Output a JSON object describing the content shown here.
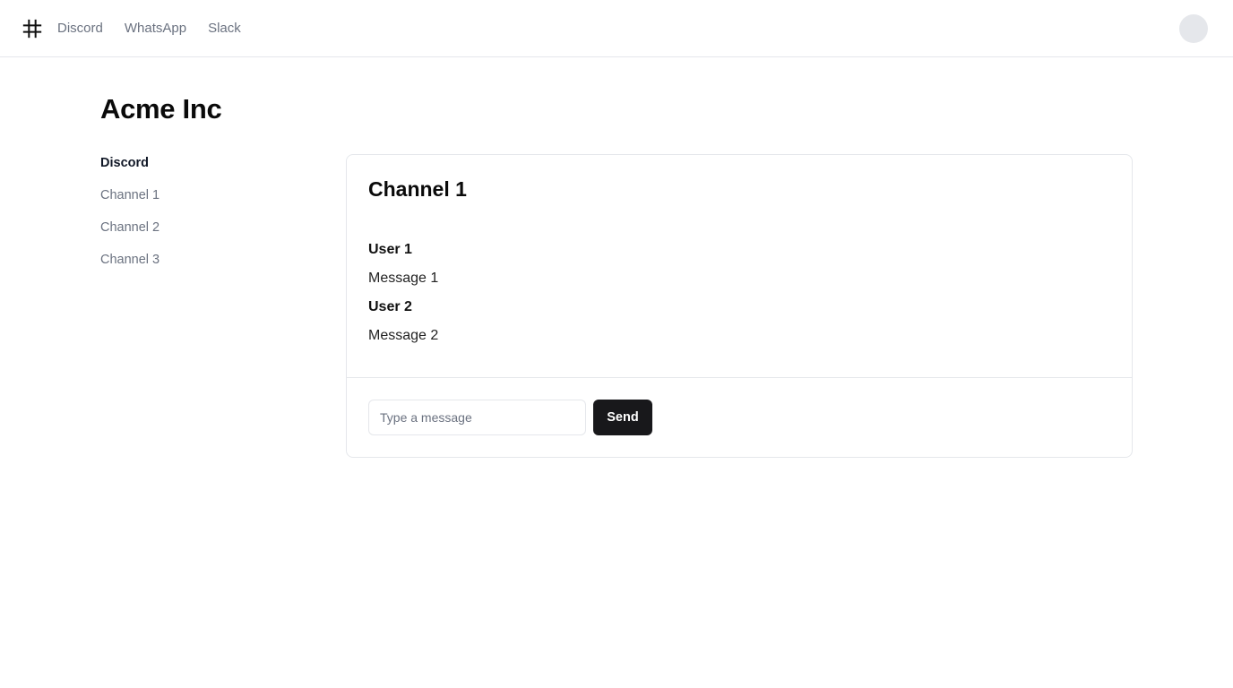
{
  "nav": {
    "logo_icon": "hash-icon",
    "links": [
      "Discord",
      "WhatsApp",
      "Slack"
    ]
  },
  "org": {
    "title": "Acme Inc"
  },
  "sidebar": {
    "items": [
      {
        "label": "Discord",
        "active": true
      },
      {
        "label": "Channel 1",
        "active": false
      },
      {
        "label": "Channel 2",
        "active": false
      },
      {
        "label": "Channel 3",
        "active": false
      }
    ]
  },
  "channel": {
    "title": "Channel 1",
    "messages": [
      {
        "user": "User 1",
        "text": "Message 1"
      },
      {
        "user": "User 2",
        "text": "Message 2"
      }
    ]
  },
  "composer": {
    "placeholder": "Type a message",
    "value": "",
    "send_label": "Send"
  },
  "colors": {
    "primary_button": "#18181b",
    "muted_text": "#6b7280",
    "border": "#e5e7eb"
  }
}
